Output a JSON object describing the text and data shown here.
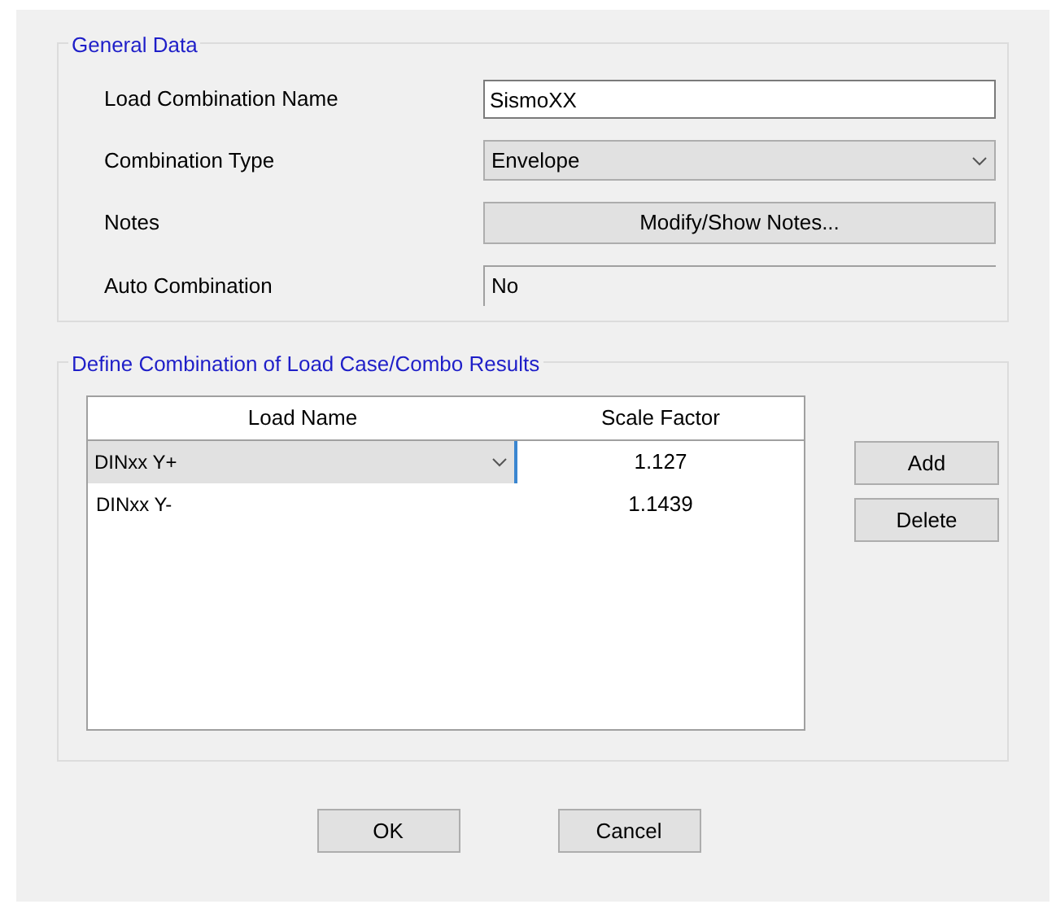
{
  "general_data": {
    "title": "General Data",
    "fields": [
      {
        "label": "Load Combination Name",
        "kind": "text",
        "value": "SismoXX"
      },
      {
        "label": "Combination Type",
        "kind": "dropdown",
        "value": "Envelope"
      },
      {
        "label": "Notes",
        "kind": "button",
        "value": "Modify/Show Notes..."
      },
      {
        "label": "Auto Combination",
        "kind": "readonly",
        "value": "No"
      }
    ]
  },
  "combination": {
    "title": "Define Combination of Load Case/Combo Results",
    "table": {
      "columns": [
        "Load Name",
        "Scale Factor"
      ],
      "rows": [
        {
          "kind": "dropdown",
          "load_name": "DINxx Y+",
          "scale_factor": "1.127"
        },
        {
          "kind": "text",
          "load_name": "DINxx Y-",
          "scale_factor": "1.1439"
        }
      ]
    },
    "buttons": [
      "Add",
      "Delete"
    ]
  },
  "buttons": [
    "OK",
    "Cancel"
  ]
}
